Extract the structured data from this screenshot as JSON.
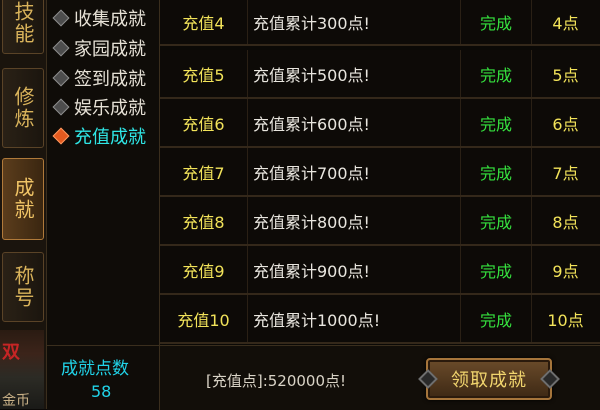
{
  "left_tabs": [
    {
      "label": "技能",
      "active": false
    },
    {
      "label": "修炼",
      "active": false
    },
    {
      "label": "成就",
      "active": true
    },
    {
      "label": "称号",
      "active": false
    }
  ],
  "left_extra": {
    "red_text": "双",
    "gold_text": "金币"
  },
  "sub_categories": [
    {
      "label": "收集成就",
      "active": false
    },
    {
      "label": "家园成就",
      "active": false
    },
    {
      "label": "签到成就",
      "active": false
    },
    {
      "label": "娱乐成就",
      "active": false
    },
    {
      "label": "充值成就",
      "active": true
    }
  ],
  "achievements": [
    {
      "name": "充值4",
      "desc": "充值累计300点!",
      "status": "完成",
      "points": "4点"
    },
    {
      "name": "充值5",
      "desc": "充值累计500点!",
      "status": "完成",
      "points": "5点"
    },
    {
      "name": "充值6",
      "desc": "充值累计600点!",
      "status": "完成",
      "points": "6点"
    },
    {
      "name": "充值7",
      "desc": "充值累计700点!",
      "status": "完成",
      "points": "7点"
    },
    {
      "name": "充值8",
      "desc": "充值累计800点!",
      "status": "完成",
      "points": "8点"
    },
    {
      "name": "充值9",
      "desc": "充值累计900点!",
      "status": "完成",
      "points": "9点"
    },
    {
      "name": "充值10",
      "desc": "充值累计1000点!",
      "status": "完成",
      "points": "10点"
    }
  ],
  "points_panel": {
    "label": "成就点数",
    "value": "58"
  },
  "footer": {
    "recharge_text": "[充值点]:520000点!",
    "claim_label": "领取成就"
  },
  "colors": {
    "accent_cyan": "#21d3e8",
    "status_green": "#35e03e",
    "name_yellow": "#f2e35a"
  }
}
